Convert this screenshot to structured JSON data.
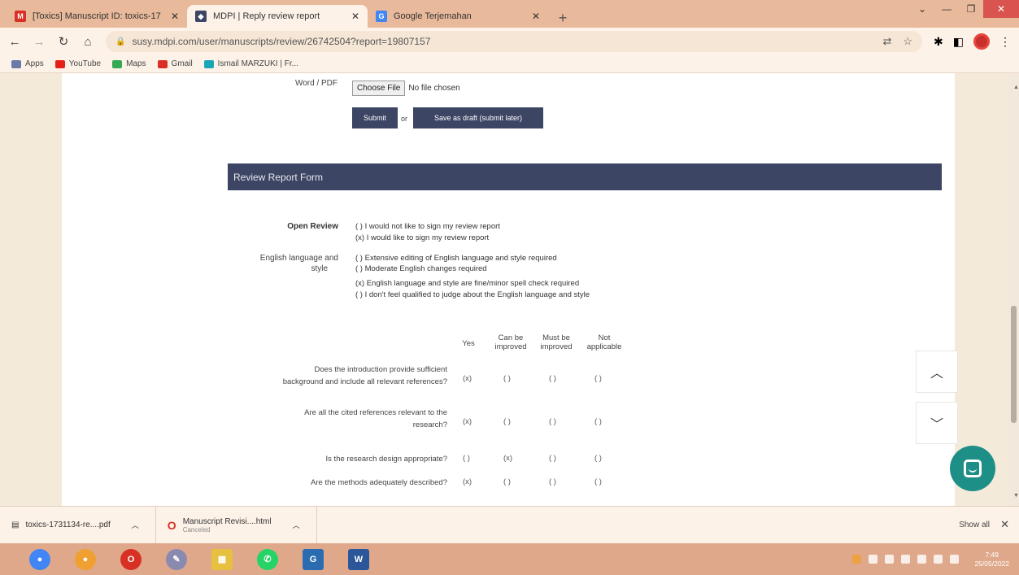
{
  "browser": {
    "tabs": [
      {
        "title": "[Toxics] Manuscript ID: toxics-17",
        "icon": "gmail-icon",
        "active": false
      },
      {
        "title": "MDPI | Reply review report",
        "icon": "mdpi-icon",
        "active": true
      },
      {
        "title": "Google Terjemahan",
        "icon": "google-translate-icon",
        "active": false
      }
    ],
    "url": "susy.mdpi.com/user/manuscripts/review/26742504?report=19807157",
    "bookmarks": [
      {
        "label": "Apps",
        "color": "#6b7ba8"
      },
      {
        "label": "YouTube",
        "color": "#e62117"
      },
      {
        "label": "Maps",
        "color": "#34a853"
      },
      {
        "label": "Gmail",
        "color": "#d93025"
      },
      {
        "label": "Ismail MARZUKI | Fr...",
        "color": "#1aa6b7"
      }
    ]
  },
  "upload": {
    "label": "Word / PDF",
    "choose_file": "Choose File",
    "no_file": "No file chosen",
    "submit": "Submit",
    "or": "or",
    "save_draft": "Save as draft (submit later)"
  },
  "form": {
    "header": "Review Report Form",
    "open_review": {
      "label": "Open Review",
      "options": [
        "( )  I would not like to sign my review report",
        "(x)  I would like to sign my review report"
      ]
    },
    "english": {
      "label_line1": "English language and",
      "label_line2": "style",
      "options": [
        "( )  Extensive editing of English language and style required",
        "( )  Moderate English changes required",
        "(x)  English language and style are fine/minor spell check required",
        "( )  I don't feel qualified to judge about the English language and style"
      ]
    },
    "columns": {
      "yes": "Yes",
      "can_be_1": "Can be",
      "can_be_2": "improved",
      "must_be_1": "Must be",
      "must_be_2": "improved",
      "not_1": "Not",
      "not_2": "applicable"
    },
    "questions": [
      {
        "line1": "Does the introduction provide sufficient",
        "line2": "background and include all relevant references?",
        "marks": [
          "(x)",
          "( )",
          "( )",
          "( )"
        ]
      },
      {
        "line1": "Are all the cited references relevant to the",
        "line2": "research?",
        "marks": [
          "(x)",
          "( )",
          "( )",
          "( )"
        ]
      },
      {
        "line1": "Is the research design appropriate?",
        "line2": "",
        "marks": [
          "( )",
          "(x)",
          "( )",
          "( )"
        ]
      },
      {
        "line1": "Are the methods adequately described?",
        "line2": "",
        "marks": [
          "(x)",
          "( )",
          "( )",
          "( )"
        ]
      }
    ]
  },
  "downloads": [
    {
      "name": "toxics-1731134-re....pdf",
      "sub": ""
    },
    {
      "name": "Manuscript Revisi....html",
      "sub": "Canceled"
    }
  ],
  "shelf": {
    "show_all": "Show all"
  },
  "taskbar": {
    "time": "7:49",
    "date": "25/05/2022"
  },
  "colors": {
    "accent": "#3d4564",
    "chat": "#1d8f86",
    "tabstrip": "#e8b99a"
  }
}
